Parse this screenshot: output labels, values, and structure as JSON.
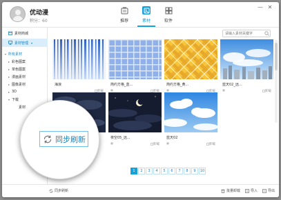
{
  "app": {
    "name": "优动漫",
    "points": "积分：60"
  },
  "tabs": [
    {
      "label": "推荐",
      "icon": "recommend-icon"
    },
    {
      "label": "素材",
      "icon": "material-icon"
    },
    {
      "label": "软件",
      "icon": "software-icon"
    }
  ],
  "window_buttons": {
    "minimize": "—",
    "close": "✕"
  },
  "sidebar": {
    "items": [
      {
        "label": "素材商城",
        "icon": "store-icon"
      },
      {
        "label": "素材管理",
        "icon": "monitor-icon"
      }
    ],
    "tree": [
      {
        "label": "所有素材",
        "arrow": "▾",
        "indent": 0
      },
      {
        "label": "彩色图案",
        "arrow": "▸",
        "indent": 1
      },
      {
        "label": "单色图案",
        "arrow": "▸",
        "indent": 1
      },
      {
        "label": "漫画素材",
        "arrow": "▸",
        "indent": 1
      },
      {
        "label": "图像素材",
        "arrow": "▸",
        "indent": 1
      },
      {
        "label": "3D",
        "arrow": "▸",
        "indent": 1
      },
      {
        "label": "下载",
        "arrow": "▾",
        "indent": 1
      },
      {
        "label": "素材",
        "arrow": "",
        "indent": 2
      }
    ]
  },
  "search": {
    "placeholder": "请输入素材关键字"
  },
  "cards": [
    {
      "name": "海浪",
      "uninstall": "卸载",
      "thumb": "blue-lines"
    },
    {
      "name": "简约方格_蓝...",
      "uninstall": "卸载",
      "thumb": "blue-grid"
    },
    {
      "name": "简约方格_黄...",
      "uninstall": "卸载",
      "thumb": "yellow-plaid"
    },
    {
      "name": "蓝天02_远...",
      "uninstall": "卸载",
      "thumb": "city-sky"
    },
    {
      "name": "",
      "uninstall": "",
      "thumb": "dark-clouds"
    },
    {
      "name": "夜空05_远...",
      "uninstall": "卸载",
      "thumb": "night-moon"
    },
    {
      "name": "蓝天02",
      "uninstall": "卸载",
      "thumb": "blue-sky"
    }
  ],
  "pagination": {
    "pages": [
      "1",
      "2",
      "3",
      "4",
      "5",
      "6",
      "7",
      "8",
      "9",
      "10"
    ],
    "current": "1"
  },
  "bottom": {
    "sync_label": "同步刷新",
    "batch_uninstall": "批量卸载",
    "import": "导入",
    "export": "导出"
  },
  "magnifier": {
    "label": "同步刷新"
  },
  "colors": {
    "accent": "#1aa0d8",
    "selected_bg": "#d9eefa"
  }
}
